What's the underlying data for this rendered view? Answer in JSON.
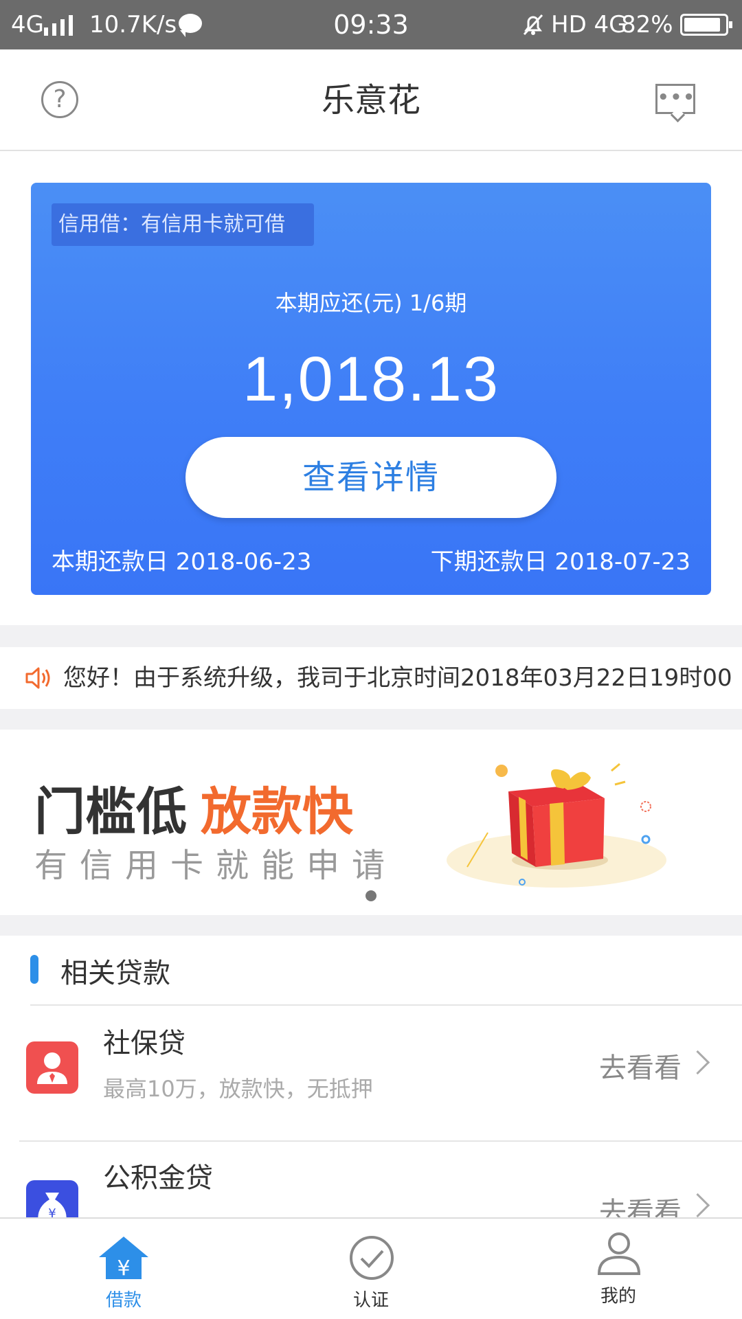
{
  "status_bar": {
    "network": "4G",
    "speed": "10.7K/s",
    "time": "09:33",
    "indicators": "HD 4G",
    "battery": "82%"
  },
  "header": {
    "title": "乐意花",
    "help_icon": "question-circle-icon",
    "message_icon": "message-bubble-icon"
  },
  "card": {
    "tag": "信用借：有信用卡就可借",
    "label": "本期应还(元)  1/6期",
    "amount": "1,018.13",
    "detail_button": "查看详情",
    "current_due": "本期还款日 2018-06-23",
    "next_due": "下期还款日 2018-07-23",
    "colors": {
      "gradient_top": "#4b8ff5",
      "gradient_bottom": "#3975f6",
      "button_text": "#2d7fe2"
    }
  },
  "notice": {
    "icon": "speaker-icon",
    "text": "您好！由于系统升级，我司于北京时间2018年03月22日19时00"
  },
  "banner": {
    "headline_plain": "门槛低",
    "headline_highlight": "放款快",
    "subline": "有信用卡就能申请",
    "image": "gift-box-illustration",
    "accent": "#f26a2e"
  },
  "related": {
    "title": "相关贷款",
    "items": [
      {
        "name": "社保贷",
        "desc": "最高10万，放款快，无抵押",
        "action": "去看看",
        "icon": "social-security-icon",
        "color": "#f05050"
      },
      {
        "name": "公积金贷",
        "desc": "",
        "action": "去看看",
        "icon": "money-bag-icon",
        "color": "#3b4fe0"
      }
    ]
  },
  "tabbar": {
    "tabs": [
      {
        "label": "借款",
        "icon": "home-yen-icon",
        "active": true
      },
      {
        "label": "认证",
        "icon": "check-circle-icon",
        "active": false
      },
      {
        "label": "我的",
        "icon": "user-icon",
        "active": false
      }
    ],
    "active_color": "#2d8fe8"
  }
}
